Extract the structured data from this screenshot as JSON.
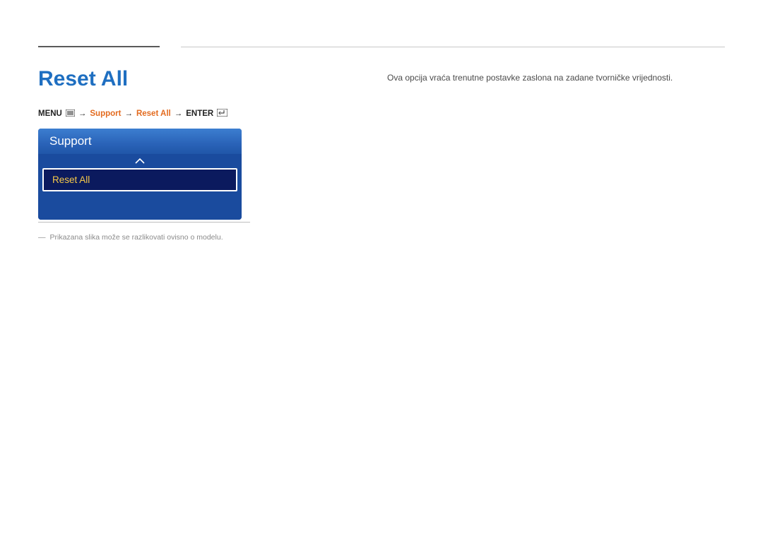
{
  "page_title": "Reset All",
  "breadcrumb": {
    "menu_label": "MENU",
    "arrow": "→",
    "support": "Support",
    "reset_all": "Reset All",
    "enter_label": "ENTER"
  },
  "description": "Ova opcija vraća trenutne postavke zaslona na zadane tvorničke vrijednosti.",
  "osd": {
    "header": "Support",
    "item": "Reset All"
  },
  "disclaimer": "Prikazana slika može se razlikovati ovisno o modelu."
}
